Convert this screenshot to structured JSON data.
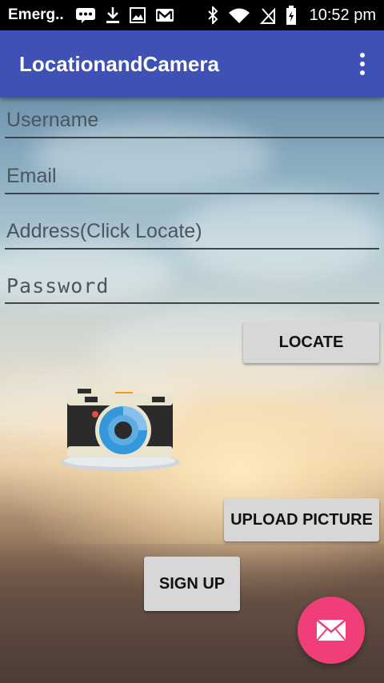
{
  "status_bar": {
    "carrier": "Emerg..",
    "time": "10:52 pm",
    "icons": [
      "message-icon",
      "download-icon",
      "image-icon",
      "gmail-icon",
      "bluetooth-icon",
      "wifi-icon",
      "no-sim-icon",
      "battery-charging-icon"
    ]
  },
  "app_bar": {
    "title": "LocationandCamera",
    "overflow_icon": "more-vert-icon"
  },
  "form": {
    "username_placeholder": "Username",
    "email_placeholder": "Email",
    "address_placeholder": "Address(Click Locate)",
    "password_placeholder": "Password"
  },
  "buttons": {
    "locate": "LOCATE",
    "upload_picture": "UPLOAD PICTURE",
    "sign_up": "SIGN UP"
  },
  "fab": {
    "icon": "mail-icon",
    "color": "#ef3e78"
  },
  "colors": {
    "app_bar": "#3f51b5",
    "status_bar": "#000000",
    "button": "#d7d7d7"
  }
}
